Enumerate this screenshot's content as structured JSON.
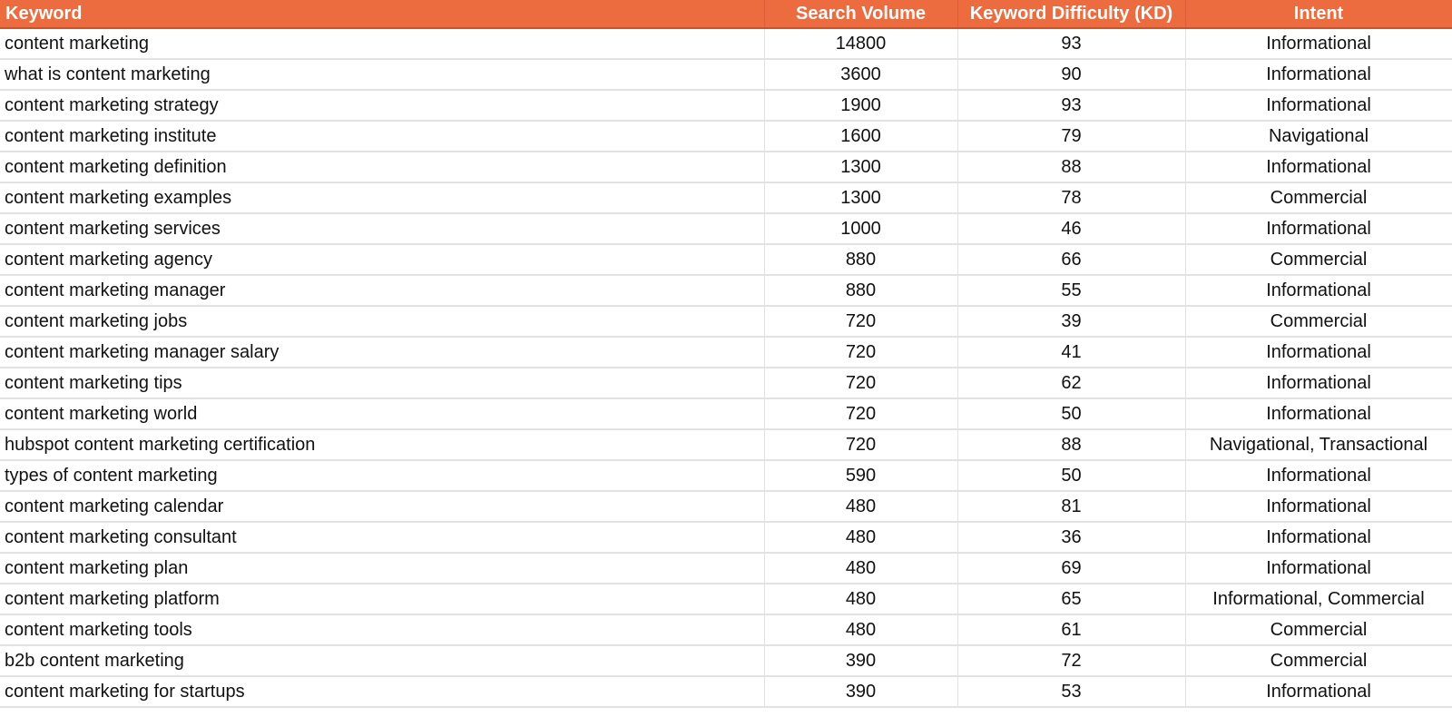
{
  "colors": {
    "header_bg": "#ec6c3f",
    "header_text": "#ffffff",
    "grid": "#e2e2e2"
  },
  "table": {
    "headers": [
      "Keyword",
      "Search Volume",
      "Keyword Difficulty (KD)",
      "Intent"
    ],
    "rows": [
      {
        "keyword": "content marketing",
        "volume": "14800",
        "kd": "93",
        "intent": "Informational"
      },
      {
        "keyword": "what is content marketing",
        "volume": "3600",
        "kd": "90",
        "intent": "Informational"
      },
      {
        "keyword": "content marketing strategy",
        "volume": "1900",
        "kd": "93",
        "intent": "Informational"
      },
      {
        "keyword": "content marketing institute",
        "volume": "1600",
        "kd": "79",
        "intent": "Navigational"
      },
      {
        "keyword": "content marketing definition",
        "volume": "1300",
        "kd": "88",
        "intent": "Informational"
      },
      {
        "keyword": "content marketing examples",
        "volume": "1300",
        "kd": "78",
        "intent": "Commercial"
      },
      {
        "keyword": "content marketing services",
        "volume": "1000",
        "kd": "46",
        "intent": "Informational"
      },
      {
        "keyword": "content marketing agency",
        "volume": "880",
        "kd": "66",
        "intent": "Commercial"
      },
      {
        "keyword": "content marketing manager",
        "volume": "880",
        "kd": "55",
        "intent": "Informational"
      },
      {
        "keyword": "content marketing jobs",
        "volume": "720",
        "kd": "39",
        "intent": "Commercial"
      },
      {
        "keyword": "content marketing manager salary",
        "volume": "720",
        "kd": "41",
        "intent": "Informational"
      },
      {
        "keyword": "content marketing tips",
        "volume": "720",
        "kd": "62",
        "intent": "Informational"
      },
      {
        "keyword": "content marketing world",
        "volume": "720",
        "kd": "50",
        "intent": "Informational"
      },
      {
        "keyword": "hubspot content marketing certification",
        "volume": "720",
        "kd": "88",
        "intent": "Navigational, Transactional"
      },
      {
        "keyword": "types of content marketing",
        "volume": "590",
        "kd": "50",
        "intent": "Informational"
      },
      {
        "keyword": "content marketing calendar",
        "volume": "480",
        "kd": "81",
        "intent": "Informational"
      },
      {
        "keyword": "content marketing consultant",
        "volume": "480",
        "kd": "36",
        "intent": "Informational"
      },
      {
        "keyword": "content marketing plan",
        "volume": "480",
        "kd": "69",
        "intent": "Informational"
      },
      {
        "keyword": "content marketing platform",
        "volume": "480",
        "kd": "65",
        "intent": "Informational, Commercial"
      },
      {
        "keyword": "content marketing tools",
        "volume": "480",
        "kd": "61",
        "intent": "Commercial"
      },
      {
        "keyword": "b2b content marketing",
        "volume": "390",
        "kd": "72",
        "intent": "Commercial"
      },
      {
        "keyword": "content marketing for startups",
        "volume": "390",
        "kd": "53",
        "intent": "Informational"
      }
    ]
  }
}
